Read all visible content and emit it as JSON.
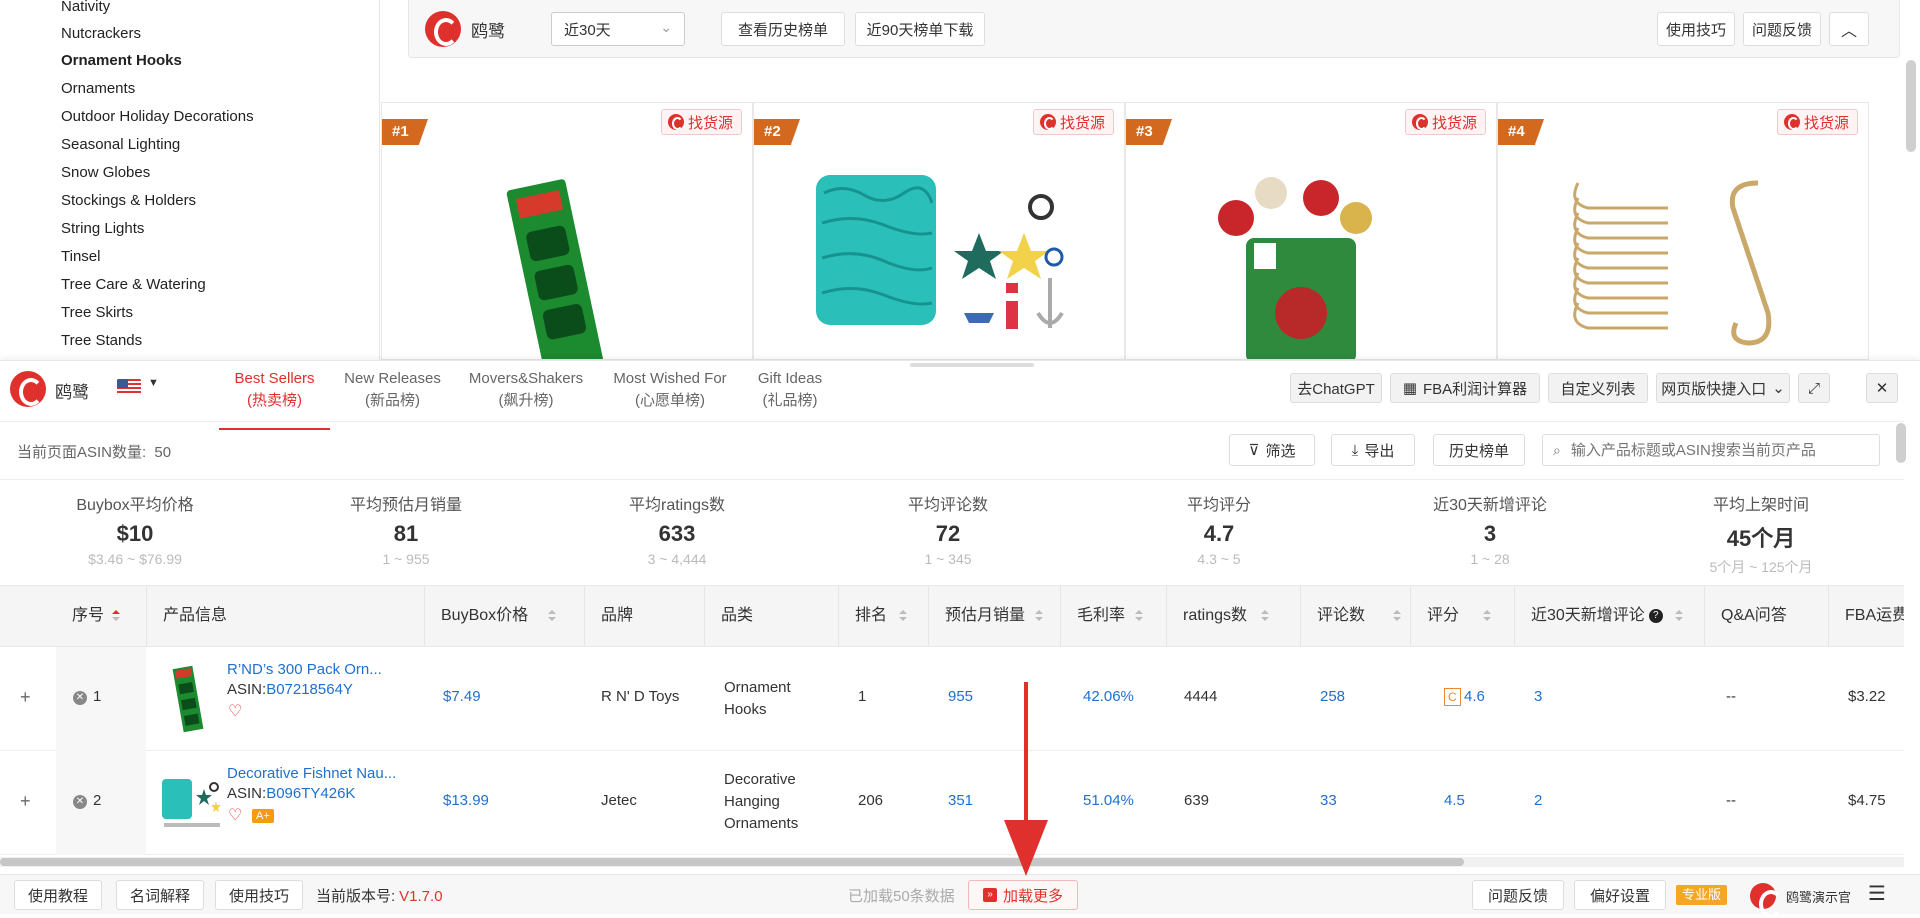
{
  "sidebar": {
    "items": [
      {
        "label": "Nativity",
        "active": false
      },
      {
        "label": "Nutcrackers",
        "active": false
      },
      {
        "label": "Ornament Hooks",
        "active": true
      },
      {
        "label": "Ornaments",
        "active": false
      },
      {
        "label": "Outdoor Holiday Decorations",
        "active": false
      },
      {
        "label": "Seasonal Lighting",
        "active": false
      },
      {
        "label": "Snow Globes",
        "active": false
      },
      {
        "label": "Stockings & Holders",
        "active": false
      },
      {
        "label": "String Lights",
        "active": false
      },
      {
        "label": "Tinsel",
        "active": false
      },
      {
        "label": "Tree Care & Watering",
        "active": false
      },
      {
        "label": "Tree Skirts",
        "active": false
      },
      {
        "label": "Tree Stands",
        "active": false
      }
    ]
  },
  "toolbar": {
    "brand": "鸥鹭",
    "range_select": "近30天",
    "history_btn": "查看历史榜单",
    "download_btn": "近90天榜单下载",
    "tips_btn": "使用技巧",
    "feedback_btn": "问题反馈",
    "accent": "#e0302d"
  },
  "cards": [
    {
      "rank": "#1",
      "find_label": "找货源"
    },
    {
      "rank": "#2",
      "find_label": "找货源"
    },
    {
      "rank": "#3",
      "find_label": "找货源"
    },
    {
      "rank": "#4",
      "find_label": "找货源"
    }
  ],
  "panel": {
    "brand": "鸥鹭",
    "tabs": [
      {
        "en": "Best Sellers",
        "cn": "(热卖榜)",
        "active": true
      },
      {
        "en": "New Releases",
        "cn": "(新品榜)",
        "active": false
      },
      {
        "en": "Movers&Shakers",
        "cn": "(飙升榜)",
        "active": false
      },
      {
        "en": "Most Wished For",
        "cn": "(心愿单榜)",
        "active": false
      },
      {
        "en": "Gift Ideas",
        "cn": "(礼品榜)",
        "active": false
      }
    ],
    "chatgpt_btn": "去ChatGPT",
    "fba_btn": "FBA利润计算器",
    "custom_btn": "自定义列表",
    "web_btn": "网页版快捷入口",
    "asin_count_label": "当前页面ASIN数量:",
    "asin_count": "50",
    "filter_btn": "筛选",
    "export_btn": "导出",
    "history_btn": "历史榜单",
    "search_placeholder": "输入产品标题或ASIN搜索当前页产品"
  },
  "stats": [
    {
      "label": "Buybox平均价格",
      "value": "$10",
      "range": "$3.46 ~ $76.99"
    },
    {
      "label": "平均预估月销量",
      "value": "81",
      "range": "1 ~ 955"
    },
    {
      "label": "平均ratings数",
      "value": "633",
      "range": "3 ~ 4,444"
    },
    {
      "label": "平均评论数",
      "value": "72",
      "range": "1 ~ 345"
    },
    {
      "label": "平均评分",
      "value": "4.7",
      "range": "4.3 ~ 5"
    },
    {
      "label": "近30天新增评论",
      "value": "3",
      "range": "1 ~ 28"
    },
    {
      "label": "平均上架时间",
      "value": "45个月",
      "range": "5个月 ~ 125个月"
    }
  ],
  "table": {
    "headers": {
      "no": "序号",
      "info": "产品信息",
      "price": "BuyBox价格",
      "brand": "品牌",
      "category": "品类",
      "rank": "排名",
      "monthly": "预估月销量",
      "margin": "毛利率",
      "ratings": "ratings数",
      "reviews": "评论数",
      "score": "评分",
      "new_reviews": "近30天新增评论",
      "qa": "Q&A问答",
      "fba": "FBA运费"
    },
    "rows": [
      {
        "no": "1",
        "title": "R’ND’s 300 Pack Orn...",
        "asin_label": "ASIN:",
        "asin": "B07218564Y",
        "price": "$7.49",
        "brand": "R N' D Toys",
        "category": "Ornament Hooks",
        "rank": "1",
        "monthly": "955",
        "margin": "42.06%",
        "ratings": "4444",
        "reviews": "258",
        "score_badge": "C",
        "score": "4.6",
        "new_reviews": "3",
        "qa": "--",
        "fba": "$3.22"
      },
      {
        "no": "2",
        "title": "Decorative Fishnet Nau...",
        "asin_label": "ASIN:",
        "asin": "B096TY426K",
        "price": "$13.99",
        "brand": "Jetec",
        "category": "Decorative Hanging Ornaments",
        "rank": "206",
        "monthly": "351",
        "margin": "51.04%",
        "ratings": "639",
        "reviews": "33",
        "score_badge": "",
        "score": "4.5",
        "new_reviews": "2",
        "qa": "--",
        "fba": "$4.75",
        "aplus": "A+"
      }
    ]
  },
  "footer": {
    "tutorial_btn": "使用教程",
    "glossary_btn": "名词解释",
    "tips_btn": "使用技巧",
    "version_label": "当前版本号:",
    "version": "V1.7.0",
    "loaded_text": "已加载50条数据",
    "load_more_btn": "加载更多",
    "feedback_btn": "问题反馈",
    "prefs_btn": "偏好设置",
    "pro_badge": "专业版",
    "account": "鸥鹭演示官"
  }
}
